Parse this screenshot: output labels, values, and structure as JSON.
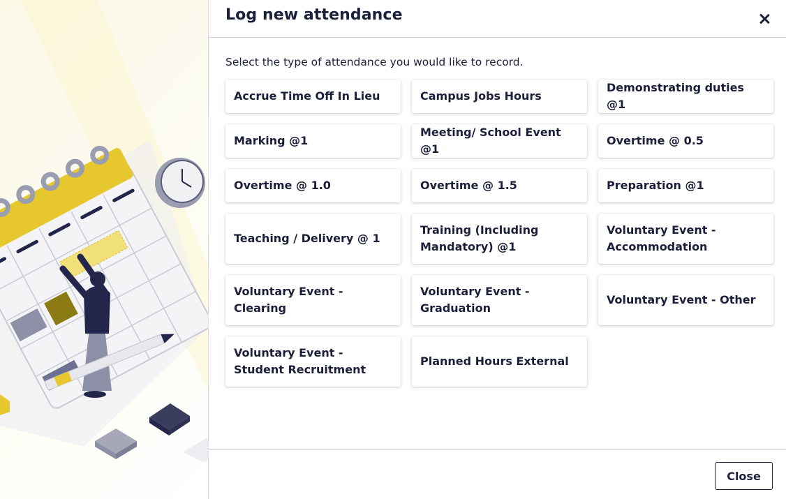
{
  "dialog": {
    "title": "Log new attendance",
    "instructions": "Select the type of attendance you would like to record.",
    "footer_close_label": "Close"
  },
  "options": [
    "Accrue Time Off In Lieu",
    "Campus Jobs Hours",
    "Demonstrating duties @1",
    "Marking @1",
    "Meeting/ School Event @1",
    "Overtime @ 0.5",
    "Overtime @ 1.0",
    "Overtime @ 1.5",
    "Preparation @1",
    "Teaching / Delivery @ 1",
    "Training (Including Mandatory) @1",
    "Voluntary Event - Accommodation",
    "Voluntary Event - Clearing",
    "Voluntary Event - Graduation",
    "Voluntary Event - Other",
    "Voluntary Event - Student Recruitment",
    "Planned Hours External"
  ],
  "icons": {
    "close": "close-icon",
    "illustration": "calendar-illustration"
  },
  "colors": {
    "accent_yellow": "#e6c82e",
    "navy": "#1b1f3a",
    "divider": "#cfd0d6"
  }
}
